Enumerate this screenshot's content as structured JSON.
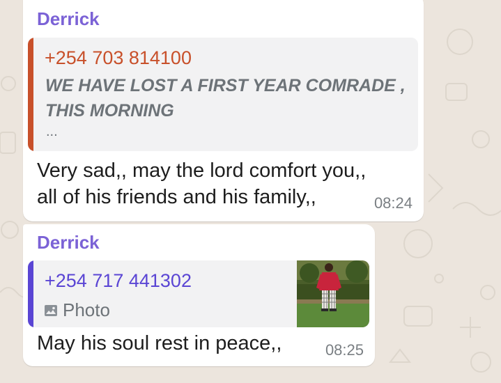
{
  "colors": {
    "sender_name": "#7b62d6",
    "quote1_accent": "#c8502a",
    "quote2_accent": "#5a45d4",
    "bubble_bg": "#ffffff",
    "quote_bg": "#f2f2f3",
    "chat_bg": "#ece5dd"
  },
  "messages": [
    {
      "sender": "Derrick",
      "quoted": {
        "sender": "+254 703 814100",
        "text": "WE HAVE LOST A FIRST YEAR COMRADE ,\nTHIS MORNING",
        "more": "..."
      },
      "text": "Very sad,, may the lord comfort you,,\nall of his friends and his family,,",
      "time": "08:24"
    },
    {
      "sender": "Derrick",
      "quoted": {
        "sender": "+254 717 441302",
        "media_icon": "photo-icon",
        "media_label": "Photo"
      },
      "text": "May his soul rest in peace,,",
      "time": "08:25"
    }
  ]
}
